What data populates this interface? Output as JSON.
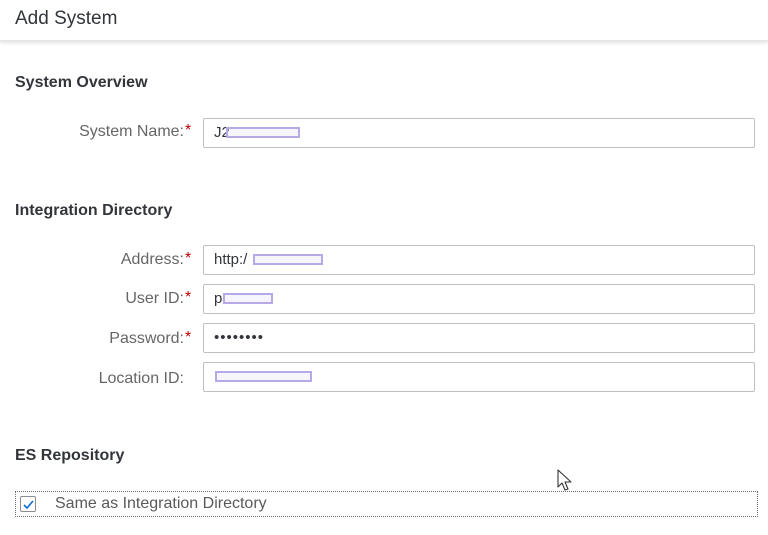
{
  "dialog": {
    "title": "Add System"
  },
  "system_overview": {
    "heading": "System Overview",
    "system_name": {
      "label": "System Name:",
      "required_mark": "*",
      "value": "J2"
    }
  },
  "integration_directory": {
    "heading": "Integration Directory",
    "address": {
      "label": "Address:",
      "required_mark": "*",
      "value": "http:/"
    },
    "user_id": {
      "label": "User ID:",
      "required_mark": "*",
      "value": "p"
    },
    "password": {
      "label": "Password:",
      "required_mark": "*",
      "value": "••••••••"
    },
    "location_id": {
      "label": "Location ID:",
      "value": ""
    }
  },
  "es_repository": {
    "heading": "ES Repository",
    "same_as_checkbox": {
      "label": "Same as Integration Directory",
      "checked": true
    }
  },
  "colors": {
    "required": "#bb0000",
    "checkmark": "#0a6ed1",
    "redaction": "#b7a9e8"
  },
  "icons": {
    "checkbox_check": "checkmark-icon",
    "mouse_cursor": "mouse-pointer-icon"
  }
}
